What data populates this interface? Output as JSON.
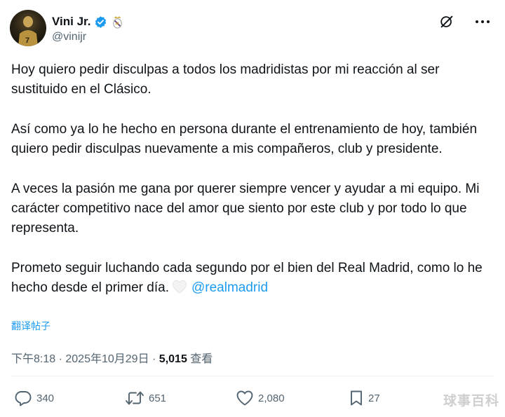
{
  "author": {
    "display_name": "Vini Jr.",
    "handle": "@vinijr",
    "verified": true
  },
  "tweet": {
    "paragraphs": [
      "Hoy quiero pedir disculpas a todos los madridistas por mi reacción al ser sustituido en el Clásico.",
      "Así como ya lo he hecho en persona durante el entrenamiento de hoy, también quiero pedir disculpas nuevamente a mis compañeros, club y presidente.",
      "A veces la pasión me gana por querer siempre vencer y ayudar a mi equipo. Mi carácter competitivo nace del amor que siento por este club y por todo lo que representa.",
      "Prometo seguir luchando cada segundo por el bien del Real Madrid, como lo he hecho desde el primer día."
    ],
    "emoji": "white-heart",
    "mention": "@realmadrid",
    "translate_label": "翻译帖子"
  },
  "meta": {
    "time": "下午8:18",
    "separator": " · ",
    "date": "2025年10月29日",
    "views_count": "5,015",
    "views_label": "查看"
  },
  "actions": {
    "replies": "340",
    "reposts": "651",
    "likes": "2,080",
    "bookmarks": "27"
  },
  "watermark": "球事百科",
  "colors": {
    "accent": "#1d9bf0",
    "text": "#0f1419",
    "muted": "#536471"
  }
}
